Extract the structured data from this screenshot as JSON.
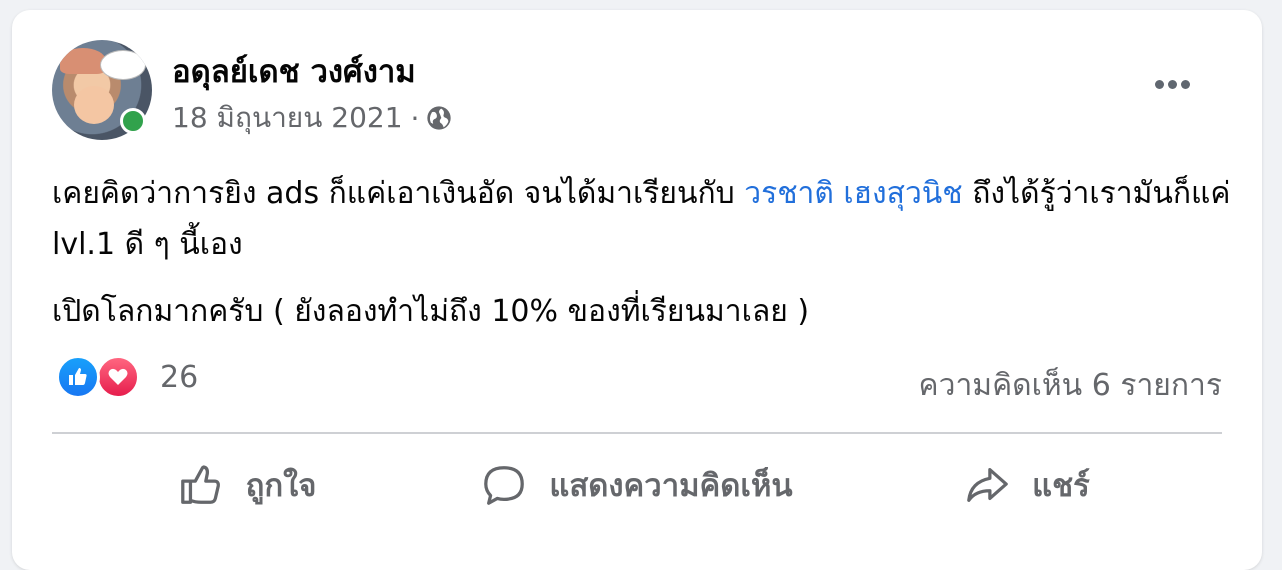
{
  "post": {
    "author": "อดุลย์เดช วงศ์งาม",
    "date": "18 มิถุนายน 2021",
    "separator": "·",
    "privacy_icon": "globe-icon",
    "text_part1": "เคยคิดว่าการยิง ads ก็แค่เอาเงินอัด จนได้มาเรียนกับ ",
    "mention": "วรชาติ เฮงสุวนิช",
    "text_part2": " ถึงได้รู้ว่าเรามันก็แค่ lvl.1 ดี ๆ นี้เอง",
    "text_second": "เปิดโลกมากครับ ( ยังลองทำไม่ถึง 10% ของที่เรียนมาเลย )"
  },
  "reactions": {
    "icons": [
      "like-icon",
      "love-icon"
    ],
    "count": "26",
    "comments": "ความคิดเห็น 6 รายการ"
  },
  "actions": {
    "like": "ถูกใจ",
    "comment": "แสดงความคิดเห็น",
    "share": "แชร์"
  },
  "colors": {
    "link": "#216fdb",
    "secondary_text": "#65676b",
    "online": "#31a24c",
    "like": "#1877f2",
    "love": "#e61e4d"
  }
}
